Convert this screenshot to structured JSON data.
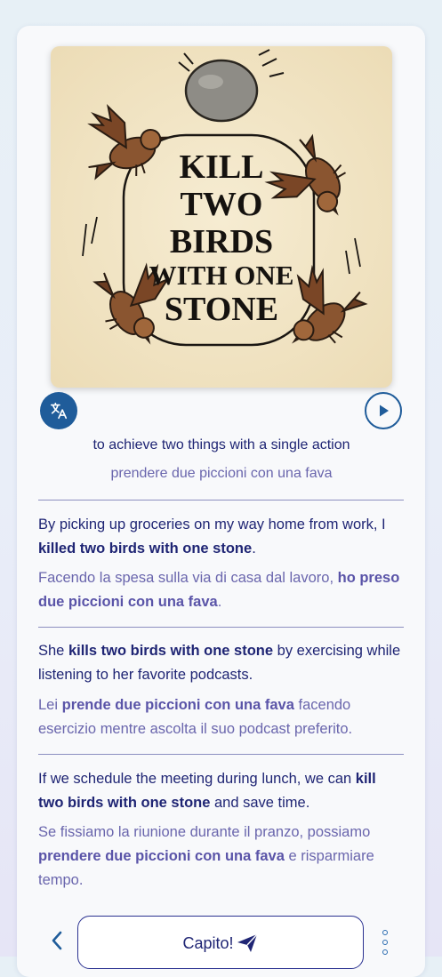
{
  "illustration": {
    "title_lines": [
      "KILL",
      "TWO",
      "BIRDS",
      "WITH ONE",
      "STONE"
    ]
  },
  "controls": {
    "translate_icon": "translate-icon",
    "play_icon": "play-icon"
  },
  "definition": {
    "en": "to achieve two things with a single action",
    "it": "prendere due piccioni con una fava"
  },
  "examples": [
    {
      "en": {
        "before": "By picking up groceries on my way home from work, I ",
        "bold": "killed two birds with one stone",
        "after": "."
      },
      "it": {
        "before": "Facendo la spesa sulla via di casa dal lavoro, ",
        "bold": "ho preso due piccioni con una fava",
        "after": "."
      }
    },
    {
      "en": {
        "before": "She ",
        "bold": "kills two birds with one stone",
        "after": " by exercising while listening to her favorite podcasts."
      },
      "it": {
        "before": "Lei ",
        "bold": "prende due piccioni con una fava",
        "after": " facendo esercizio mentre ascolta il suo podcast preferito."
      }
    },
    {
      "en": {
        "before": "If we schedule the meeting during lunch, we can ",
        "bold": "kill two birds with one stone",
        "after": " and save time."
      },
      "it": {
        "before": "Se fissiamo la riunione durante il pranzo, possiamo ",
        "bold": "prendere due piccioni con una fava",
        "after": " e risparmiare tempo."
      }
    }
  ],
  "bottom_bar": {
    "back_icon": "chevron-left-icon",
    "confirm_label": "Capito!",
    "confirm_icon": "send-icon",
    "more_icon": "more-vertical-icon"
  },
  "colors": {
    "primary_text": "#1f2574",
    "secondary_text": "#6a66ad",
    "accent": "#1f5c9a",
    "illustration_bg": "#f2e6c7"
  }
}
